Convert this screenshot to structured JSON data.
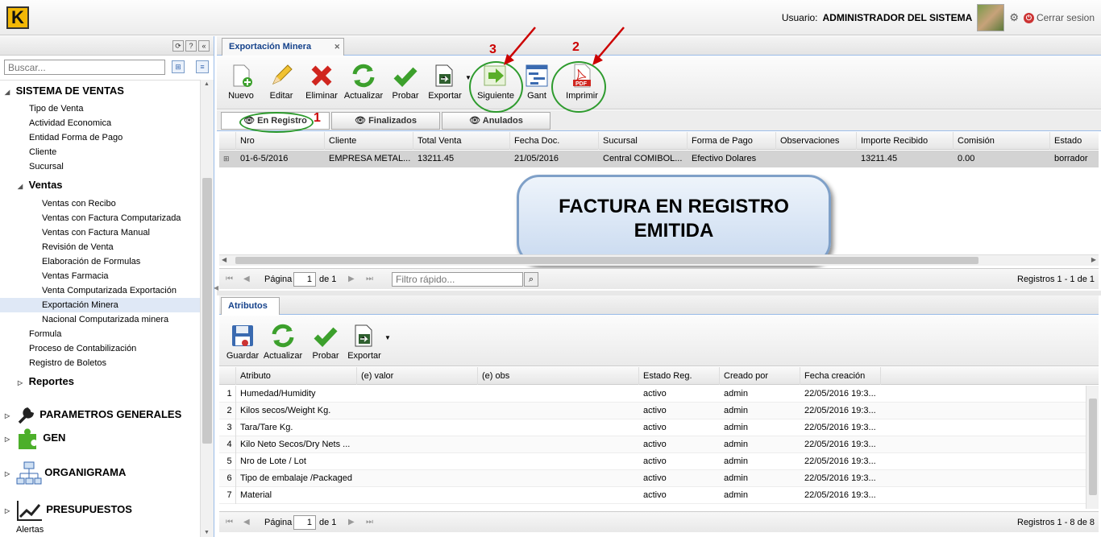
{
  "header": {
    "logo_letter": "K",
    "user_label": "Usuario:",
    "user_name": "ADMINISTRADOR DEL SISTEMA",
    "logout_label": "Cerrar sesion"
  },
  "sidebar": {
    "search_placeholder": "Buscar...",
    "tree": [
      {
        "label": "SISTEMA DE VENTAS",
        "level": "h1"
      },
      {
        "label": "Tipo de Venta"
      },
      {
        "label": "Actividad Economica"
      },
      {
        "label": "Entidad Forma de Pago"
      },
      {
        "label": "Cliente"
      },
      {
        "label": "Sucursal"
      },
      {
        "label": "Ventas",
        "level": "h2"
      },
      {
        "label": "Ventas con Recibo"
      },
      {
        "label": "Ventas con Factura Computarizada"
      },
      {
        "label": "Ventas con Factura Manual"
      },
      {
        "label": "Revisión de Venta"
      },
      {
        "label": "Elaboración de Formulas"
      },
      {
        "label": "Ventas Farmacia"
      },
      {
        "label": "Venta Computarizada Exportación"
      },
      {
        "label": "Exportación Minera",
        "selected": true
      },
      {
        "label": "Nacional Computarizada minera"
      },
      {
        "label": "Formula"
      },
      {
        "label": "Proceso de Contabilización"
      },
      {
        "label": "Registro de Boletos"
      },
      {
        "label": "Reportes",
        "level": "h2"
      },
      {
        "label": "PARAMETROS GENERALES",
        "level": "h1"
      },
      {
        "label": "GEN",
        "level": "h1"
      },
      {
        "label": "ORGANIGRAMA",
        "level": "h1"
      },
      {
        "label": "PRESUPUESTOS",
        "level": "h1"
      },
      {
        "label": "Alertas"
      }
    ]
  },
  "main": {
    "tab_title": "Exportación Minera",
    "toolbar": [
      "Nuevo",
      "Editar",
      "Eliminar",
      "Actualizar",
      "Probar",
      "Exportar",
      "Siguiente",
      "Gant",
      "Imprimir"
    ],
    "subtabs": [
      "En Registro",
      "Finalizados",
      "Anulados"
    ],
    "columns": [
      "Nro",
      "Cliente",
      "Total Venta",
      "Fecha Doc.",
      "Sucursal",
      "Forma de Pago",
      "Observaciones",
      "Importe Recibido",
      "Comisión",
      "Estado"
    ],
    "row": [
      "01-6-5/2016",
      "EMPRESA METAL...",
      "13211.45",
      "21/05/2016",
      "Central COMIBOL...",
      "Efectivo Dolares",
      "",
      "13211.45",
      "0.00",
      "borrador"
    ],
    "annotation_line1": "FACTURA EN REGISTRO",
    "annotation_line2": "EMITIDA",
    "callout_numbers": [
      "1",
      "2",
      "3"
    ],
    "pager": {
      "page_label": "Página",
      "page_value": "1",
      "of_label": "de 1",
      "filter_placeholder": "Filtro rápido...",
      "records": "Registros 1 - 1 de 1"
    }
  },
  "details": {
    "tab_title": "Atributos",
    "toolbar": [
      "Guardar",
      "Actualizar",
      "Probar",
      "Exportar"
    ],
    "columns": [
      "Atributo",
      "(e) valor",
      "(e) obs",
      "Estado Reg.",
      "Creado por",
      "Fecha creación"
    ],
    "rows": [
      {
        "n": "1",
        "attr": "Humedad/Humidity",
        "estado": "activo",
        "por": "admin",
        "fecha": "22/05/2016 19:3..."
      },
      {
        "n": "2",
        "attr": "Kilos secos/Weight Kg.",
        "estado": "activo",
        "por": "admin",
        "fecha": "22/05/2016 19:3..."
      },
      {
        "n": "3",
        "attr": "Tara/Tare Kg.",
        "estado": "activo",
        "por": "admin",
        "fecha": "22/05/2016 19:3..."
      },
      {
        "n": "4",
        "attr": "Kilo Neto Secos/Dry Nets ...",
        "estado": "activo",
        "por": "admin",
        "fecha": "22/05/2016 19:3..."
      },
      {
        "n": "5",
        "attr": "Nro de Lote / Lot",
        "estado": "activo",
        "por": "admin",
        "fecha": "22/05/2016 19:3..."
      },
      {
        "n": "6",
        "attr": "Tipo de embalaje /Packaged",
        "estado": "activo",
        "por": "admin",
        "fecha": "22/05/2016 19:3..."
      },
      {
        "n": "7",
        "attr": "Material",
        "estado": "activo",
        "por": "admin",
        "fecha": "22/05/2016 19:3..."
      }
    ],
    "pager": {
      "page_label": "Página",
      "page_value": "1",
      "of_label": "de 1",
      "records": "Registros 1 - 8 de 8"
    }
  }
}
